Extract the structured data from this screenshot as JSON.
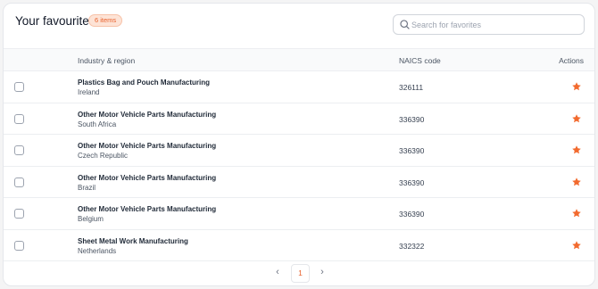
{
  "header": {
    "title": "Your favourites",
    "count_badge": "6 items",
    "search_placeholder": "Search for favorites"
  },
  "table": {
    "columns": {
      "industry": "Industry & region",
      "naics": "NAICS code",
      "actions": "Actions"
    },
    "rows": [
      {
        "industry": "Plastics Bag and Pouch Manufacturing",
        "region": "Ireland",
        "naics": "326111"
      },
      {
        "industry": "Other Motor Vehicle Parts Manufacturing",
        "region": "South Africa",
        "naics": "336390"
      },
      {
        "industry": "Other Motor Vehicle Parts Manufacturing",
        "region": "Czech Republic",
        "naics": "336390"
      },
      {
        "industry": "Other Motor Vehicle Parts Manufacturing",
        "region": "Brazil",
        "naics": "336390"
      },
      {
        "industry": "Other Motor Vehicle Parts Manufacturing",
        "region": "Belgium",
        "naics": "336390"
      },
      {
        "industry": "Sheet Metal Work Manufacturing",
        "region": "Netherlands",
        "naics": "332322"
      }
    ]
  },
  "pagination": {
    "current_page": "1",
    "prev_icon": "chevron-left-icon",
    "next_icon": "chevron-right-icon"
  },
  "icons": {
    "search": "search-icon",
    "favourite": "star-icon"
  },
  "colors": {
    "accent": "#e8612c",
    "badge_bg": "#fde3d6",
    "star": "#f26a2e"
  }
}
